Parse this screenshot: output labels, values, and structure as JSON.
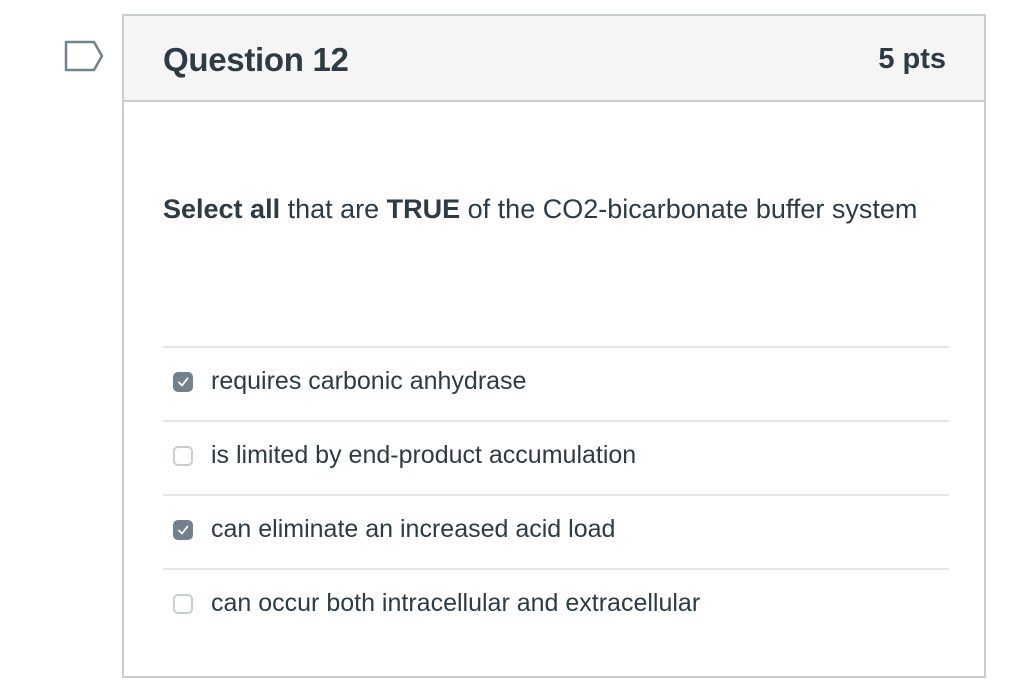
{
  "question": {
    "title": "Question 12",
    "points": "5 pts",
    "prompt_part1_bold": "Select all",
    "prompt_part2": " that are ",
    "prompt_part3_bold": "TRUE",
    "prompt_part4": " of the CO2-bicarbonate buffer system",
    "flag_icon": "flag-outline-icon"
  },
  "answers": [
    {
      "label": "requires carbonic anhydrase",
      "checked": true
    },
    {
      "label": "is limited by end-product accumulation",
      "checked": false
    },
    {
      "label": "can eliminate an increased acid load",
      "checked": true
    },
    {
      "label": "can occur both intracellular and extracellular",
      "checked": false
    }
  ],
  "colors": {
    "header_bg": "#f5f5f5",
    "border": "#c7cdd1",
    "text": "#2d3b45",
    "checkbox_checked": "#73818c"
  }
}
